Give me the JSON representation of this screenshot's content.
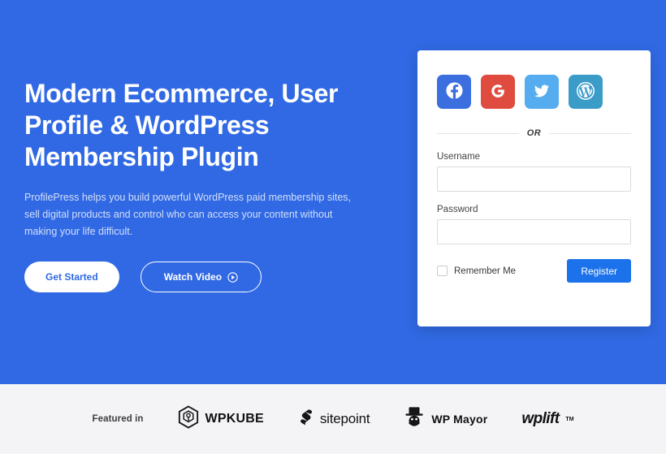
{
  "hero": {
    "headline": "Modern Ecommerce, User Profile & WordPress Membership Plugin",
    "subcopy": "ProfilePress helps you build powerful WordPress paid membership sites, sell digital products and control who can access your content without making your life difficult.",
    "primary_cta": "Get Started",
    "secondary_cta": "Watch Video",
    "background_color": "#3069e3"
  },
  "login_card": {
    "social_buttons": [
      {
        "name": "facebook",
        "icon": "facebook-icon",
        "color": "#3b6fe0"
      },
      {
        "name": "google",
        "icon": "google-icon",
        "color": "#e04b3f"
      },
      {
        "name": "twitter",
        "icon": "twitter-icon",
        "color": "#55acee"
      },
      {
        "name": "wordpress",
        "icon": "wordpress-icon",
        "color": "#3b9cc8"
      }
    ],
    "divider_text": "OR",
    "username_label": "Username",
    "username_value": "",
    "password_label": "Password",
    "password_value": "",
    "remember_label": "Remember Me",
    "remember_checked": false,
    "register_label": "Register",
    "register_color": "#1b72ea"
  },
  "footer": {
    "featured_label": "Featured in",
    "logos": [
      {
        "name": "wpkube",
        "text": "WPKUBE"
      },
      {
        "name": "sitepoint",
        "text": "sitepoint"
      },
      {
        "name": "wp-mayor",
        "text": "WP Mayor"
      },
      {
        "name": "wplift",
        "text": "wplift",
        "suffix": "TM"
      }
    ]
  }
}
